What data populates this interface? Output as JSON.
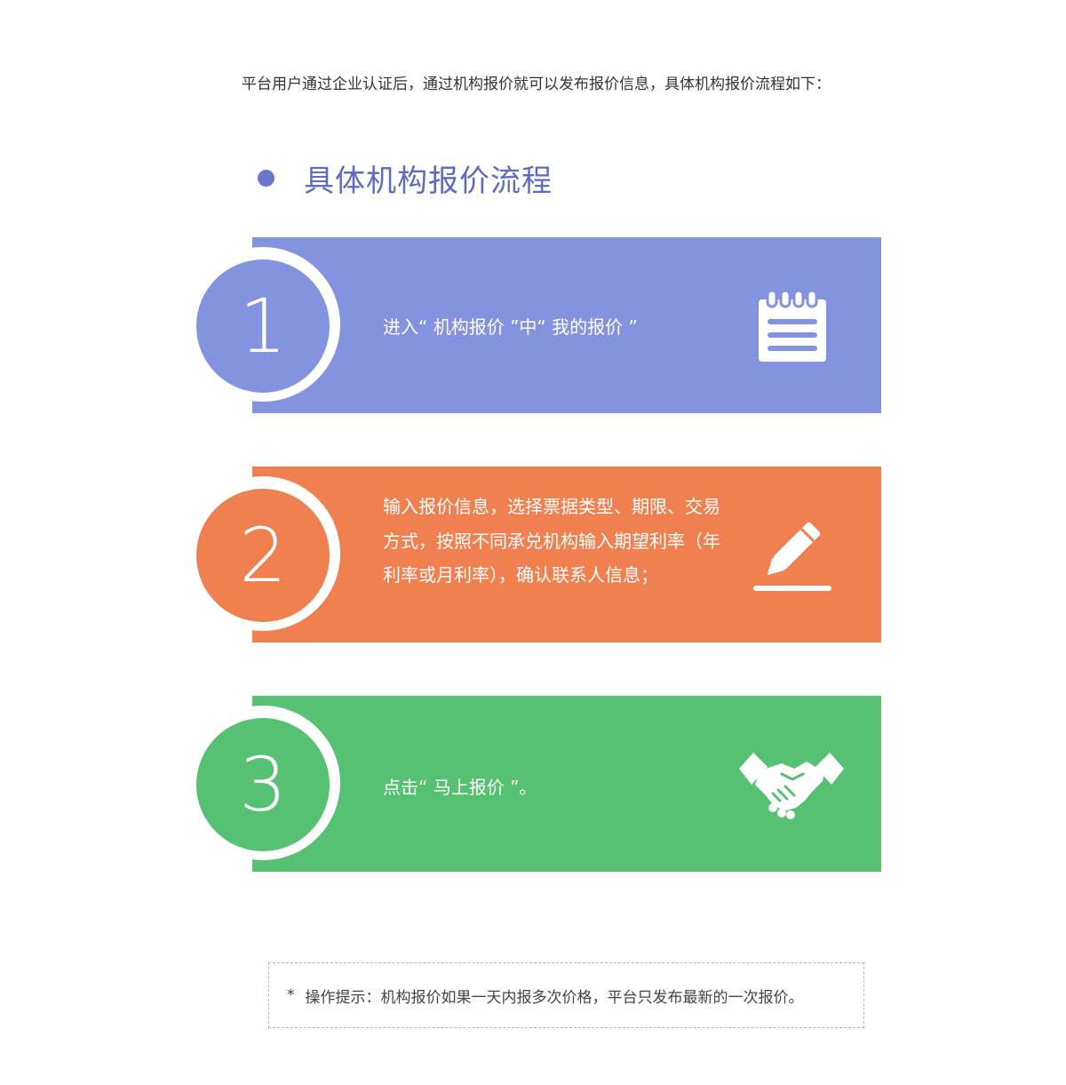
{
  "intro": "平台用户通过企业认证后，通过机构报价就可以发布报价信息，具体机构报价流程如下：",
  "section": {
    "title": "具体机构报价流程"
  },
  "steps": [
    {
      "number": "1",
      "text": "进入“ 机构报价 ”中“ 我的报价 ”",
      "color": "#8493e0",
      "icon": "notepad-icon"
    },
    {
      "number": "2",
      "text": "输入报价信息，选择票据类型、期限、交易方式，按照不同承兑机构输入期望利率（年利率或月利率），确认联系人信息；",
      "color": "#f08050",
      "icon": "pencil-icon"
    },
    {
      "number": "3",
      "text": "点击“ 马上报价 ”。",
      "color": "#56c172",
      "icon": "handshake-icon"
    }
  ],
  "tip": {
    "star": "*",
    "text": "操作提示：机构报价如果一天内报多次价格，平台只发布最新的一次报价。"
  },
  "colors": {
    "accent": "#5d6bc4",
    "step1": "#8493e0",
    "step2": "#f08050",
    "step3": "#56c172"
  }
}
